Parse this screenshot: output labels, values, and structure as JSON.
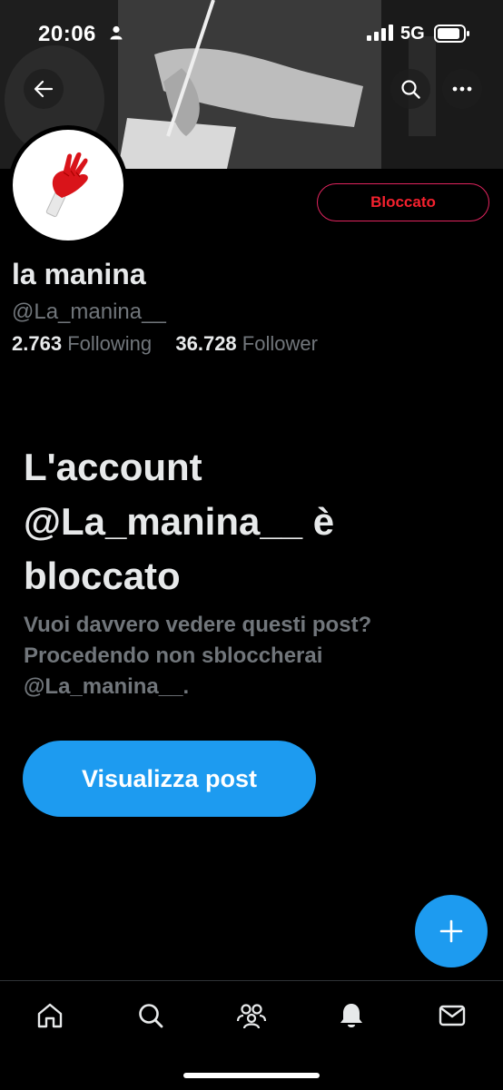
{
  "status_bar": {
    "time": "20:06",
    "network": "5G"
  },
  "profile": {
    "display_name": "la manina",
    "handle": "@La_manina__",
    "following_count": "2.763",
    "following_label": "Following",
    "follower_count": "36.728",
    "follower_label": "Follower",
    "blocked_label": "Bloccato"
  },
  "blocked_notice": {
    "headline": "L'account @La_manina__ è bloccato",
    "body": "Vuoi davvero vedere questi post? Procedendo non sbloccherai @La_manina__.",
    "view_button": "Visualizza post"
  },
  "colors": {
    "accent": "#1d9bf0",
    "blocked_red": "#f4212e",
    "muted_text": "#71767b"
  },
  "icons": {
    "header": [
      "back-arrow-icon",
      "search-icon",
      "more-icon"
    ],
    "fab": "plus-icon",
    "tabbar": [
      "home-icon",
      "search-icon",
      "communities-icon",
      "notifications-bell-icon",
      "messages-envelope-icon"
    ]
  }
}
